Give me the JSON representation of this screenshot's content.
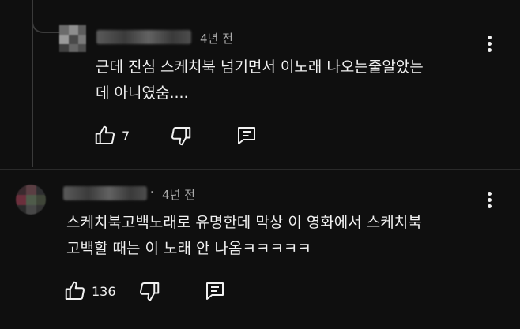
{
  "reply": {
    "time": "4년 전",
    "text": "근데 진심 스케치북 넘기면서 이노래 나오는줄알았는\n데 아니였숨....",
    "like_count": "7"
  },
  "comment": {
    "time": "4년 전",
    "text": "스케치북고백노래로 유명한데 막상 이 영화에서 스케치북\n고백할 때는 이 노래 안 나옴ㅋㅋㅋㅋㅋ",
    "like_count": "136"
  },
  "icons": {
    "like": "thumbs-up-icon",
    "dislike": "thumbs-down-icon",
    "reply": "reply-comment-icon",
    "more": "more-vertical-icon"
  }
}
